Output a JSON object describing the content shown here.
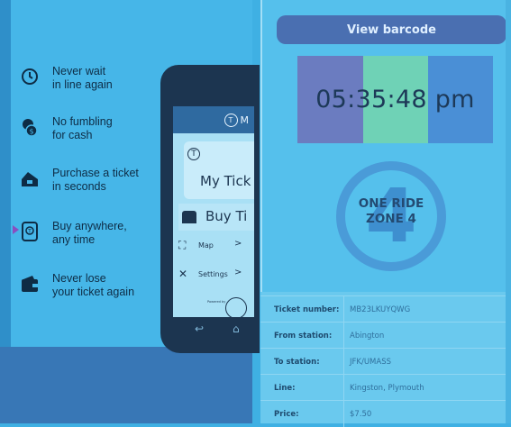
{
  "features": [
    {
      "icon": "clock-icon",
      "text": "Never wait\nin line again"
    },
    {
      "icon": "coin-icon",
      "text": "No fumbling\nfor cash"
    },
    {
      "icon": "ticket-purchase-icon",
      "text": "Purchase a ticket\nin seconds"
    },
    {
      "icon": "phone-icon",
      "text": "Buy anywhere,\nany time"
    },
    {
      "icon": "wallet-icon",
      "text": "Never lose\nyour ticket again"
    }
  ],
  "phone": {
    "header_logo": "T",
    "header_text": "M",
    "card_logo": "T",
    "my_tickets": "My Tick",
    "buy_tickets": "Buy Ti",
    "menu": [
      {
        "icon": "map-icon",
        "label": "Map",
        "chevron": ">"
      },
      {
        "icon": "settings-icon",
        "label": "Settings",
        "chevron": ">"
      }
    ],
    "powered_by": "Powered by"
  },
  "ticket": {
    "barcode_button": "View barcode",
    "clock": "05:35:48 pm",
    "zone_number": "4",
    "zone_label": "ONE RIDE\nZONE 4",
    "band_colors": [
      "#6b7cc0",
      "#6fd2b6",
      "#4a8fd6"
    ],
    "details": [
      {
        "label": "Ticket number:",
        "value": "MB23LKUYQWG"
      },
      {
        "label": "From station:",
        "value": "Abington"
      },
      {
        "label": "To station:",
        "value": "JFK/UMASS"
      },
      {
        "label": "Line:",
        "value": "Kingston, Plymouth"
      },
      {
        "label": "Price:",
        "value": "$7.50"
      }
    ]
  }
}
